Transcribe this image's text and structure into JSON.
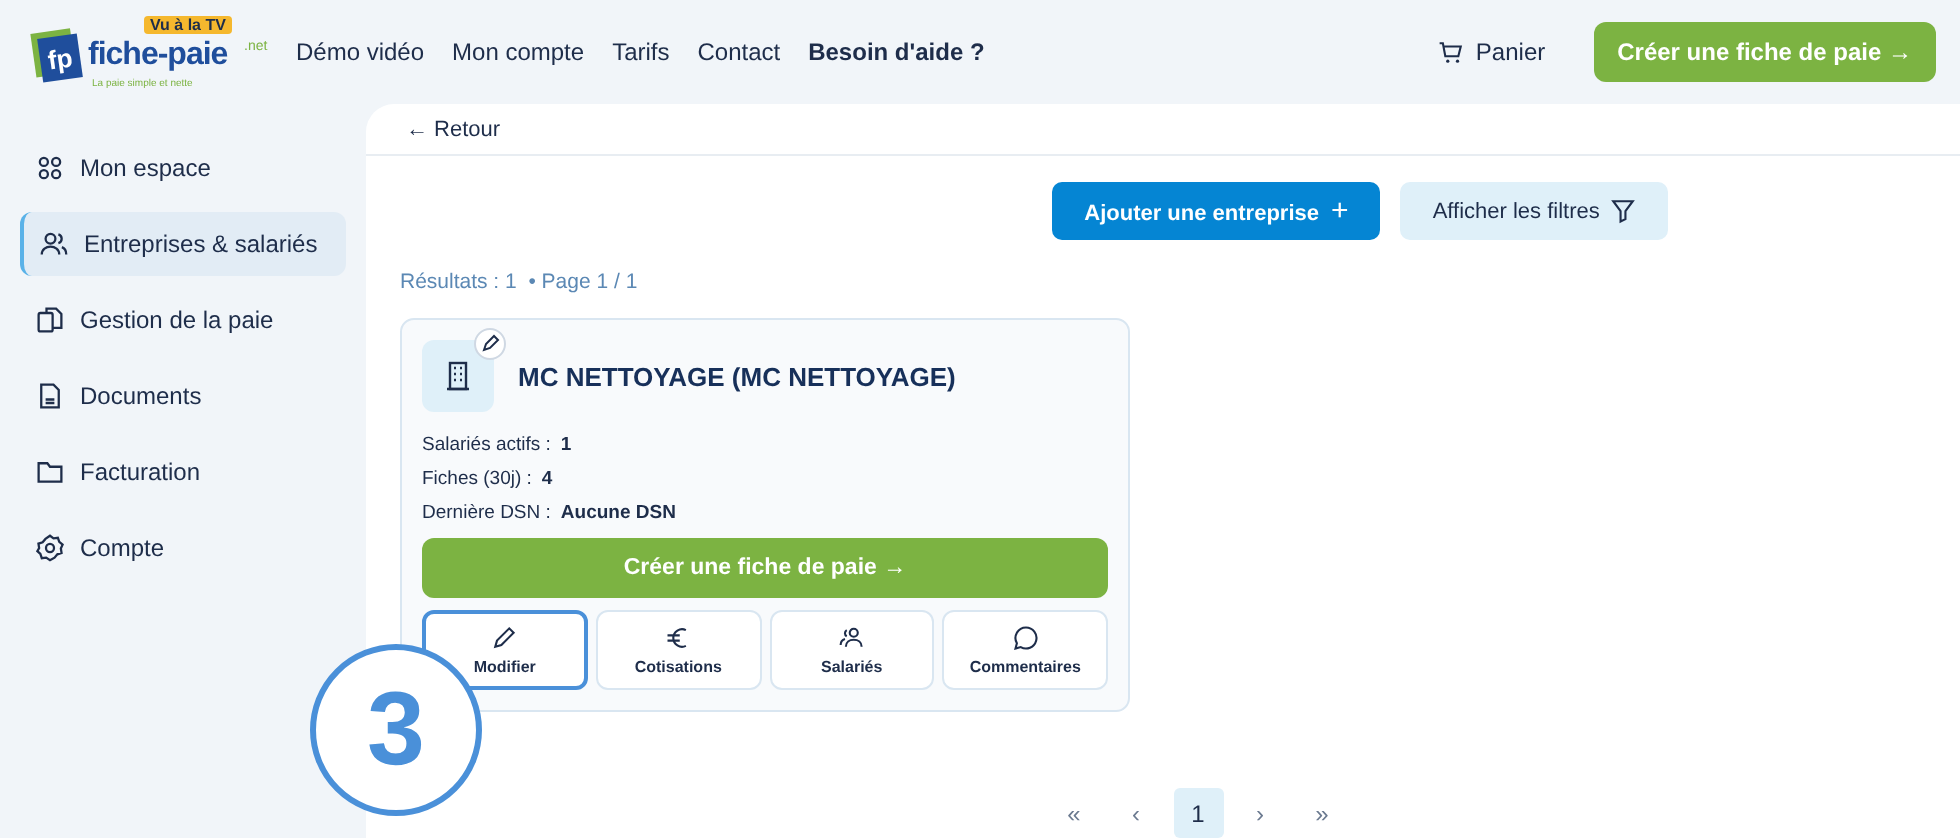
{
  "logo": {
    "mark": "fp",
    "name": "fiche-paie",
    "suffix": ".net",
    "tagline": "La paie simple et nette",
    "badge": "Vu à la TV"
  },
  "nav": [
    {
      "label": "Démo vidéo",
      "bold": false
    },
    {
      "label": "Mon compte",
      "bold": false
    },
    {
      "label": "Tarifs",
      "bold": false
    },
    {
      "label": "Contact",
      "bold": false
    },
    {
      "label": "Besoin d'aide ?",
      "bold": true
    }
  ],
  "cart": {
    "label": "Panier"
  },
  "header_cta": {
    "label": "Créer une fiche de paie",
    "arrow": "→"
  },
  "sidebar": {
    "items": [
      {
        "label": "Mon espace",
        "kind": "grid",
        "selected": false
      },
      {
        "label": "Entreprises & salariés",
        "kind": "users",
        "selected": true
      },
      {
        "label": "Gestion de la paie",
        "kind": "files",
        "selected": false
      },
      {
        "label": "Documents",
        "kind": "doc",
        "selected": false
      },
      {
        "label": "Facturation",
        "kind": "folder",
        "selected": false
      },
      {
        "label": "Compte",
        "kind": "gear",
        "selected": false
      }
    ]
  },
  "back": {
    "arrow": "←",
    "label": "Retour"
  },
  "add_button": {
    "label": "Ajouter une entreprise",
    "plus": "+"
  },
  "filter_button": {
    "label": "Afficher les filtres"
  },
  "results": "Résultats : 1  • Page 1 / 1",
  "company": {
    "name": "MC NETTOYAGE (MC NETTOYAGE)",
    "stats": [
      {
        "label": "Salariés actifs :",
        "value": "1"
      },
      {
        "label": "Fiches (30j) :",
        "value": "4"
      },
      {
        "label": "Dernière DSN :",
        "value": "Aucune DSN"
      }
    ],
    "create": {
      "label": "Créer une fiche de paie",
      "arrow": "→"
    },
    "actions": [
      {
        "label": "Modifier",
        "kind": "pencil",
        "highlighted": true
      },
      {
        "label": "Cotisations",
        "kind": "euro",
        "highlighted": false
      },
      {
        "label": "Salariés",
        "kind": "users",
        "highlighted": false
      },
      {
        "label": "Commentaires",
        "kind": "chat",
        "highlighted": false
      }
    ]
  },
  "pagination": [
    {
      "label": "«",
      "selected": false
    },
    {
      "label": "‹",
      "selected": false
    },
    {
      "label": "1",
      "selected": true
    },
    {
      "label": "›",
      "selected": false
    },
    {
      "label": "»",
      "selected": false
    }
  ],
  "step_marker": "3"
}
